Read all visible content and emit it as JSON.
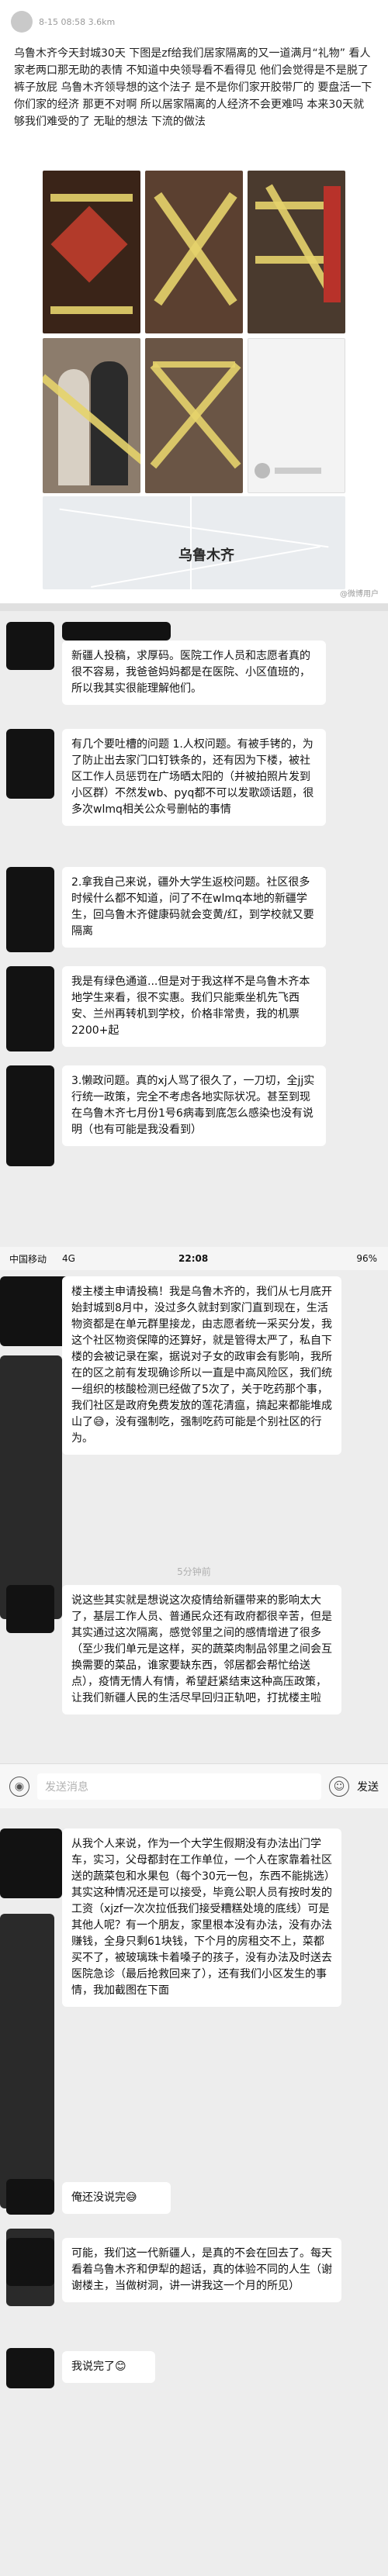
{
  "post": {
    "meta": "8-15 08:58 3.6km",
    "text": "乌鲁木齐今天封城30天 下图是zf给我们居家隔离的又一道满月“礼物” 看人家老两口那无助的表情 不知道中央领导看不看得见 他们会觉得是不是脱了裤子放屁 乌鲁木齐领导想的这个法子 是不是你们家开胶带厂的 要盘活一下你们家的经济 那更不对啊 所以居家隔离的人经济不会更难吗 本来30天就够我们难受的了 无耻的想法 下流的做法",
    "map_label": "乌鲁木齐",
    "watermark": "@微博用户"
  },
  "status_bar": {
    "carrier": "中国移动",
    "network": "4G",
    "time": "22:08",
    "battery": "96%"
  },
  "chat": {
    "timestamp": "5分钟前",
    "messages": [
      {
        "text": "新疆人投稿，求厚码。医院工作人员和志愿者真的很不容易，我爸爸妈妈都是在医院、小区值班的，所以我其实很能理解他们。"
      },
      {
        "text": "有几个要吐槽的问题 1.人权问题。有被手铐的，为了防止出去家门口钉铁条的，还有因为下楼，被社区工作人员惩罚在广场晒太阳的（并被拍照片发到小区群）不然发wb、pyq都不可以发歌颂话题，很多次wlmq相关公众号删帖的事情"
      },
      {
        "text": "2.拿我自己来说，疆外大学生返校问题。社区很多时候什么都不知道，问了不在wlmq本地的新疆学生，回乌鲁木齐健康码就会变黄/红，到学校就又要隔离"
      },
      {
        "text": "我是有绿色通道...但是对于我这样不是乌鲁木齐本地学生来看，很不实惠。我们只能乘坐机先飞西安、兰州再转机到学校，价格非常贵，我的机票2200+起"
      },
      {
        "text": "3.懒政问题。真的xj人骂了很久了，一刀切，全jj实行统一政策，完全不考虑各地实际状况。甚至到现在乌鲁木齐七月份1号6病毒到底怎么感染也没有说明（也有可能是我没看到）"
      },
      {
        "text": "楼主楼主申请投稿！我是乌鲁木齐的，我们从七月底开始封城到8月中，没过多久就封到家门直到现在，生活物资都是在单元群里接龙，由志愿者统一采买分发，我这个社区物资保障的还算好，就是管得太严了，私自下楼的会被记录在案，据说对子女的政审会有影响，我所在的区之前有发现确诊所以一直是中高风险区，我们统一组织的核酸检测已经做了5次了，关于吃药那个事，我们社区是政府免费发放的莲花清瘟，搞起来都能堆成山了😅，没有强制吃，强制吃药可能是个别社区的行为。"
      },
      {
        "text": "说这些其实就是想说这次疫情给新疆带来的影响太大了，基层工作人员、普通民众还有政府都很辛苦，但是其实通过这次隔离，感觉邻里之间的感情增进了很多（至少我们单元是这样，买的蔬菜肉制品邻里之间会互换需要的菜品，谁家要缺东西，邻居都会帮忙给送点），疫情无情人有情，希望赶紧结束这种高压政策，让我们新疆人民的生活尽早回归正轨吧，打扰楼主啦"
      },
      {
        "text": "从我个人来说，作为一个大学生假期没有办法出门学车，实习，父母都封在工作单位，一个人在家靠着社区送的蔬菜包和水果包（每个30元一包，东西不能挑选）其实这种情况还是可以接受，毕竟公职人员有按时发的工资（xjzf一次次拉低我们接受糟糕处境的底线）可是其他人呢？有一个朋友，家里根本没有办法，没有办法赚钱，全身只剩61块钱，下个月的房租交不上，菜都买不了，被玻璃珠卡着嗓子的孩子，没有办法及时送去医院急诊（最后抢救回来了），还有我们小区发生的事情，我加截图在下面"
      },
      {
        "text": "俺还没说完😅",
        "green": false
      },
      {
        "text": "可能，我们这一代新疆人，是真的不会在回去了。每天看着乌鲁木齐和伊犁的超话，真的体验不同的人生（谢谢楼主，当做树洞，讲一讲我这一个月的所见）"
      },
      {
        "text": "我说完了😊"
      }
    ]
  },
  "input_bar": {
    "placeholder": "发送消息",
    "send_label": "发送"
  }
}
